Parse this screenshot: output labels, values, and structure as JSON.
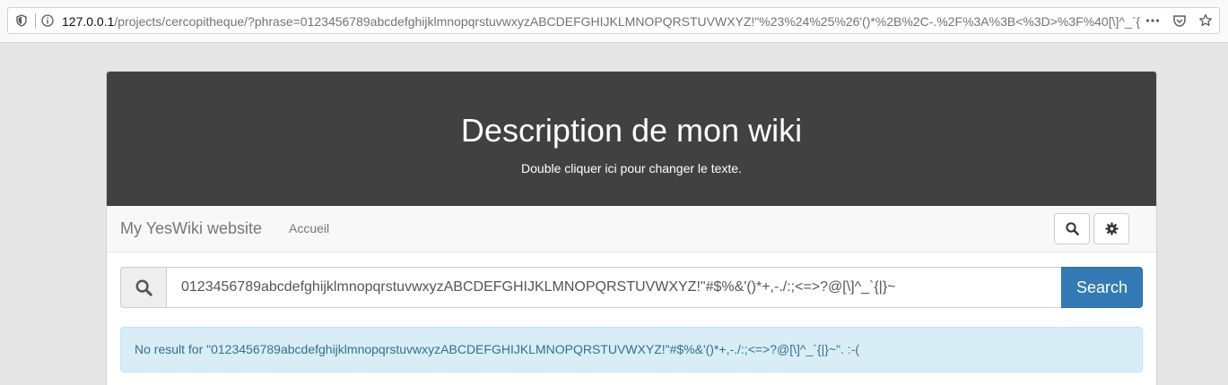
{
  "browser": {
    "url_host": "127.0.0.1",
    "url_path": "/projects/cercopitheque/?phrase=0123456789abcdefghijklmnopqrstuvwxyzABCDEFGHIJKLMNOPQRSTUVWXYZ!\"%23%24%25%26'()*%2B%2C-.%2F%3A%3B<%3D>%3F%40[\\]^_`{",
    "icons": [
      "shield-icon",
      "info-icon",
      "more-icon",
      "pocket-icon",
      "star-icon"
    ]
  },
  "header": {
    "title": "Description de mon wiki",
    "subtitle": "Double cliquer ici pour changer le texte."
  },
  "navbar": {
    "brand": "My YesWiki website",
    "link_home": "Accueil",
    "icons": [
      "search-icon",
      "gear-icon"
    ]
  },
  "search": {
    "value": "0123456789abcdefghijklmnopqrstuvwxyzABCDEFGHIJKLMNOPQRSTUVWXYZ!\"#$%&'()*+,-./:;<=>?@[\\]^_`{|}~",
    "button_label": "Search"
  },
  "result": {
    "message": "No result for \"0123456789abcdefghijklmnopqrstuvwxyzABCDEFGHIJKLMNOPQRSTUVWXYZ!\"#$%&'()*+,-./:;<=>?@[\\]^_`{|}~\". :-("
  },
  "colors": {
    "banner_bg": "#414141",
    "primary": "#337ab7",
    "alert_bg": "#d9edf7",
    "alert_text": "#31708f"
  }
}
